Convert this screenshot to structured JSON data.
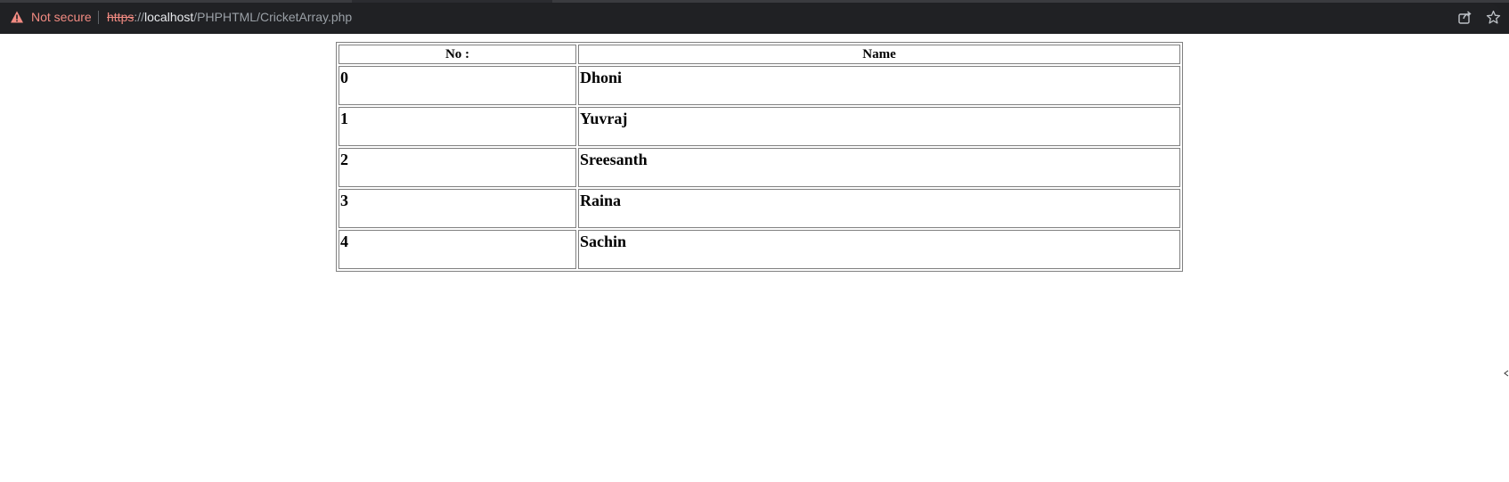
{
  "browser": {
    "security_label": "Not secure",
    "url": {
      "scheme": "https",
      "separator": "://",
      "host": "localhost",
      "path": "/PHPHTML/CricketArray.php"
    },
    "icons": [
      "warning-icon",
      "share-icon",
      "bookmark-star-icon"
    ]
  },
  "table": {
    "headers": [
      "No :",
      "Name"
    ],
    "rows": [
      {
        "no": "0",
        "name": "Dhoni"
      },
      {
        "no": "1",
        "name": "Yuvraj"
      },
      {
        "no": "2",
        "name": "Sreesanth"
      },
      {
        "no": "3",
        "name": "Raina"
      },
      {
        "no": "4",
        "name": "Sachin"
      }
    ]
  },
  "colors": {
    "chrome_background": "#202124",
    "insecure_red": "#f28b82",
    "url_host": "#e8eaed",
    "url_muted": "#9aa0a6"
  }
}
